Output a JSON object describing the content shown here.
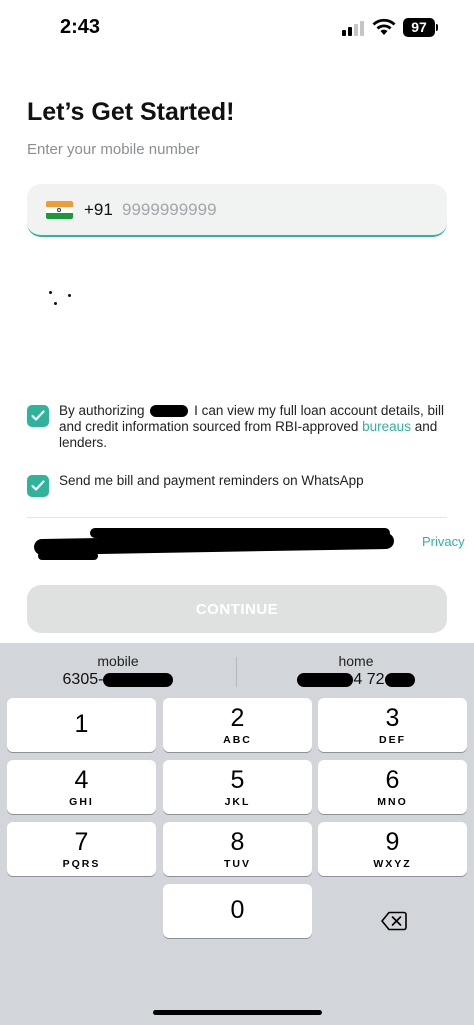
{
  "status_bar": {
    "time": "2:43",
    "battery": "97",
    "icons": [
      "signal-icon",
      "wifi-icon",
      "battery-icon"
    ]
  },
  "header": {
    "title": "Let’s Get Started!",
    "subtitle": "Enter your mobile number"
  },
  "phone": {
    "flag": "india-flag-icon",
    "country_code": "+91",
    "placeholder": "9999999999",
    "value": ""
  },
  "consents": [
    {
      "checked": true,
      "text_start": "By authorizing",
      "text_mid": " I can view my full loan account details, bill and credit information sourced from RBI-approved ",
      "link": "bureaus",
      "text_end": " and lenders."
    },
    {
      "checked": true,
      "text": "Send me bill and payment reminders on WhatsApp"
    }
  ],
  "terms": {
    "link_text": "Privacy"
  },
  "continue_button": {
    "label": "CONTINUE"
  },
  "keyboard": {
    "suggestions": [
      {
        "label": "mobile",
        "value": "6305-"
      },
      {
        "label": "home",
        "value": "4 72"
      }
    ],
    "keys": [
      {
        "digit": "1",
        "letters": ""
      },
      {
        "digit": "2",
        "letters": "ABC"
      },
      {
        "digit": "3",
        "letters": "DEF"
      },
      {
        "digit": "4",
        "letters": "GHI"
      },
      {
        "digit": "5",
        "letters": "JKL"
      },
      {
        "digit": "6",
        "letters": "MNO"
      },
      {
        "digit": "7",
        "letters": "PQRS"
      },
      {
        "digit": "8",
        "letters": "TUV"
      },
      {
        "digit": "9",
        "letters": "WXYZ"
      },
      {
        "digit": "0",
        "letters": ""
      }
    ],
    "delete_icon": "backspace-icon"
  },
  "colors": {
    "accent": "#2fb39b",
    "button_disabled": "#dfe1e1",
    "keyboard_bg": "#d2d5da"
  }
}
